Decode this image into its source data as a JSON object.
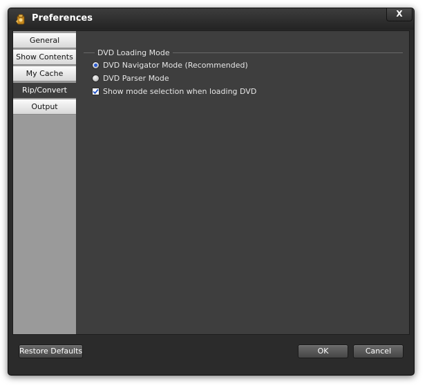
{
  "window": {
    "title": "Preferences",
    "close_label": "X"
  },
  "sidebar": {
    "items": [
      {
        "label": "General",
        "active": false
      },
      {
        "label": "Show Contents",
        "active": false
      },
      {
        "label": "My Cache",
        "active": false
      },
      {
        "label": "Rip/Convert",
        "active": true
      },
      {
        "label": "Output",
        "active": false
      }
    ]
  },
  "main": {
    "section_title": "DVD Loading Mode",
    "options": [
      {
        "type": "radio",
        "label": "DVD Navigator Mode (Recommended)",
        "checked": true
      },
      {
        "type": "radio",
        "label": "DVD Parser Mode",
        "checked": false
      },
      {
        "type": "checkbox",
        "label": "Show mode selection when loading DVD",
        "checked": true
      }
    ]
  },
  "footer": {
    "restore_label": "Restore Defaults",
    "ok_label": "OK",
    "cancel_label": "Cancel"
  },
  "colors": {
    "window_bg": "#2b2b2b",
    "panel_bg": "#3e3e3e",
    "sidebar_bg": "#9a9a9a",
    "accent": "#2a5ad0"
  },
  "icons": {
    "app": "dvd-app-icon",
    "close": "close-icon",
    "check": "checkmark-icon"
  }
}
